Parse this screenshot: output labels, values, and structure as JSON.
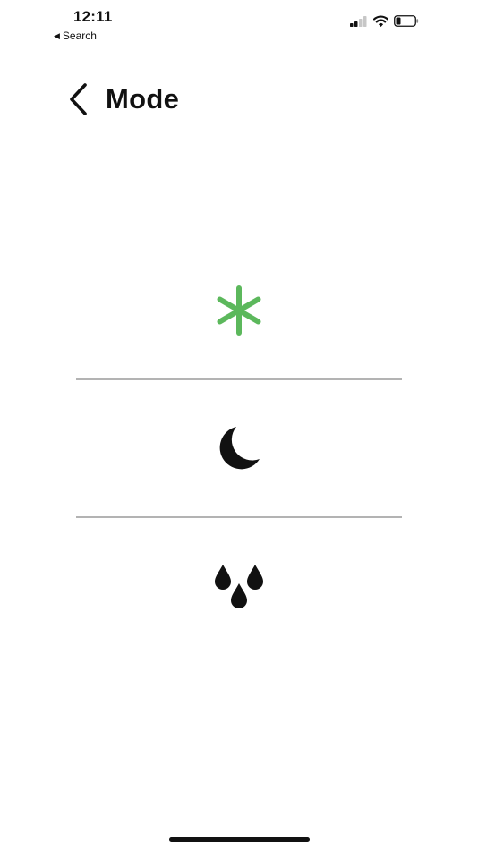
{
  "status_bar": {
    "time": "12:11",
    "back_app_label": "Search"
  },
  "header": {
    "title": "Mode"
  },
  "modes": [
    {
      "icon": "snowflake-asterisk-icon",
      "selected": true,
      "color": "#5cb85c"
    },
    {
      "icon": "moon-icon",
      "selected": false,
      "color": "#111111"
    },
    {
      "icon": "water-drops-icon",
      "selected": false,
      "color": "#111111"
    }
  ],
  "colors": {
    "accent": "#5cb85c",
    "divider": "#b3b3b3",
    "text": "#111111"
  }
}
